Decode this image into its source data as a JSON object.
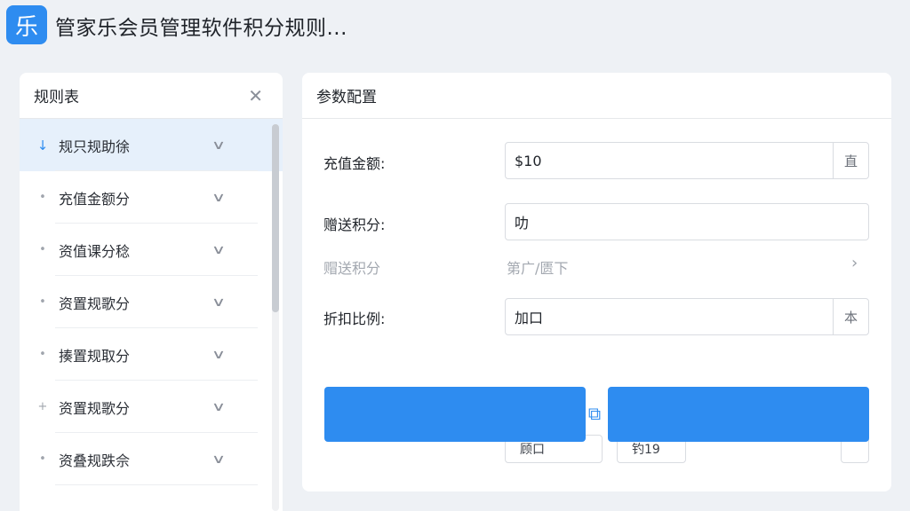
{
  "app": {
    "logo_char": "乐",
    "title": "管家乐会员管理软件积分规则..."
  },
  "sidebar": {
    "title": "规则表",
    "close_glyph": "✕",
    "items": [
      {
        "bullet": "↓",
        "label": "规只规助徐",
        "active": true
      },
      {
        "bullet": "•",
        "label": "充值金额分",
        "active": false
      },
      {
        "bullet": "•",
        "label": "资值课分稔",
        "active": false
      },
      {
        "bullet": "•",
        "label": "资置规歌分",
        "active": false
      },
      {
        "bullet": "•",
        "label": "揍置规取分",
        "active": false
      },
      {
        "bullet": "+",
        "label": "资置规歌分",
        "active": false
      },
      {
        "bullet": "•",
        "label": "资叠规跌佘",
        "active": false
      }
    ],
    "chevron_glyph": "∨"
  },
  "config": {
    "title": "参数配置",
    "recharge": {
      "label": "充值金额:",
      "value": "$10",
      "suffix": "直"
    },
    "bonus": {
      "label": "赠送积分:",
      "value": "叻"
    },
    "bonus_readonly": {
      "label": "赗送积分",
      "value": "第广/匮下",
      "chevron": "›"
    },
    "discount": {
      "label": "折扣比例:",
      "value": "加口",
      "suffix": "本"
    },
    "buttons": {
      "left_label": "",
      "right_label": ""
    },
    "connector_glyph": "⧉",
    "mini_boxes": [
      "顾口",
      "钓19",
      ""
    ]
  },
  "colors": {
    "accent": "#2e8cf0",
    "background": "#eef1f5",
    "active_row": "#e6f0fb"
  }
}
